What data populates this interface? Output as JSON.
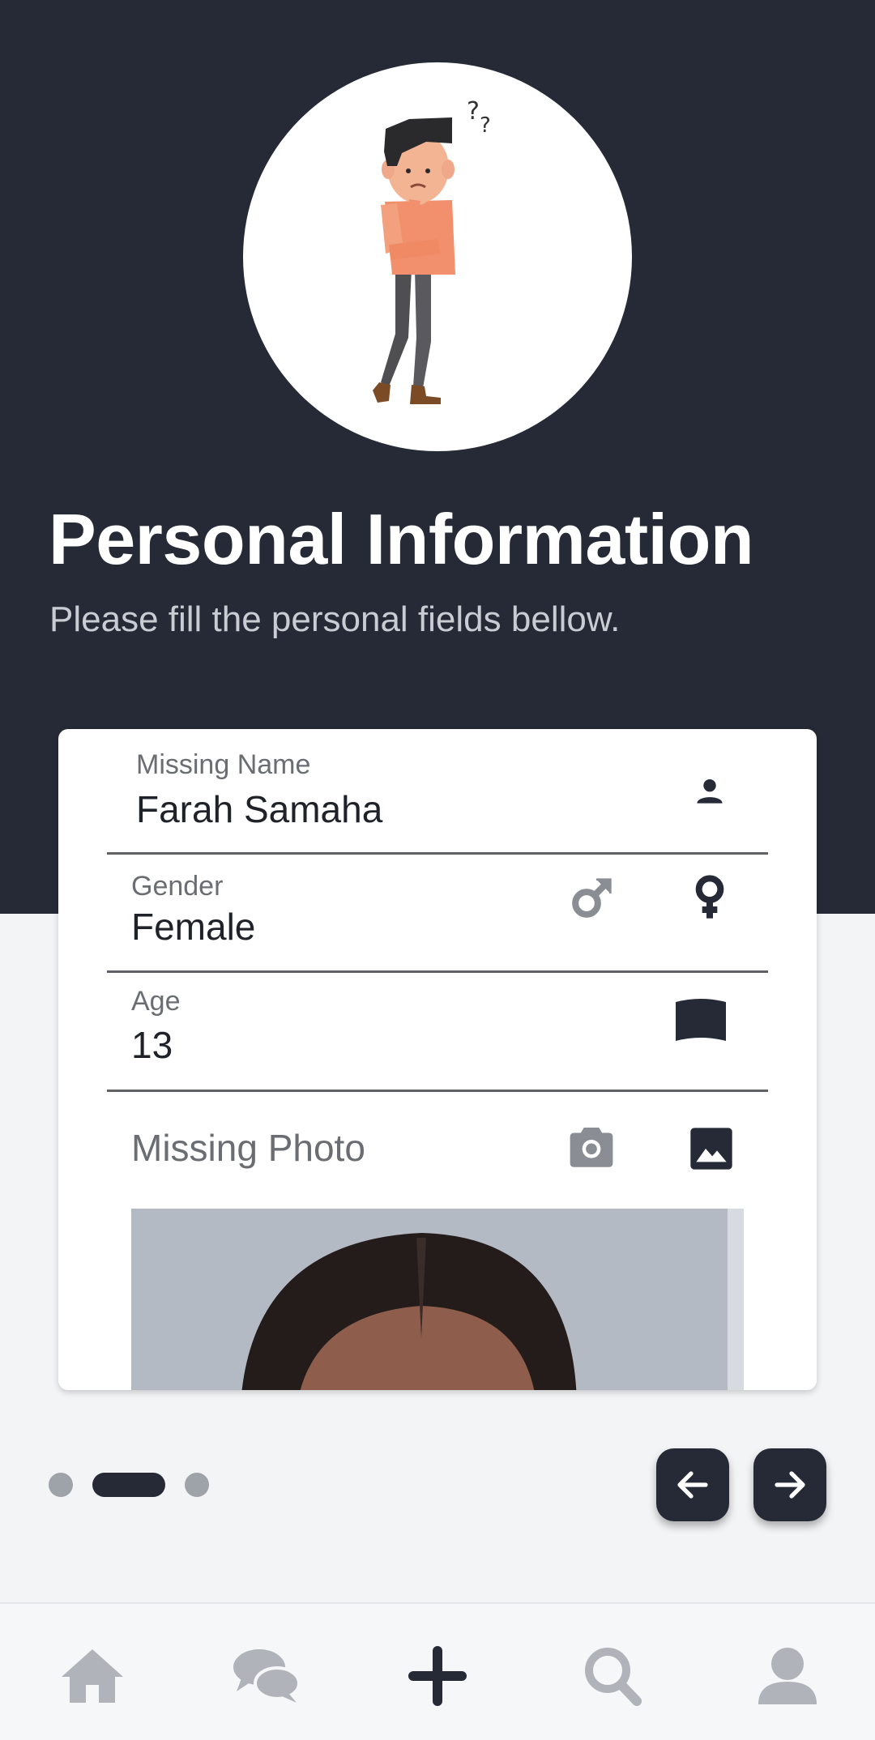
{
  "header": {
    "title": "Personal Information",
    "subtitle": "Please fill the personal fields bellow."
  },
  "form": {
    "name": {
      "label": "Missing Name",
      "value": "Farah Samaha",
      "icon": "person-icon"
    },
    "gender": {
      "label": "Gender",
      "value": "Female",
      "options": [
        "male-icon",
        "female-icon"
      ],
      "selected": "female"
    },
    "age": {
      "label": "Age",
      "value": "13",
      "icon": "flag-icon"
    },
    "photo": {
      "label": "Missing Photo",
      "icons": [
        "camera-icon",
        "image-icon"
      ]
    }
  },
  "pager": {
    "total": 3,
    "active_index": 1
  },
  "nav_buttons": [
    "back-arrow-icon",
    "forward-arrow-icon"
  ],
  "bottom_nav": {
    "items": [
      "home-icon",
      "chat-icon",
      "add-icon",
      "search-icon",
      "profile-icon"
    ],
    "active": "add-icon"
  },
  "colors": {
    "dark": "#252a36",
    "page_bg": "#f3f4f6",
    "muted_icon": "#8a8d93",
    "inactive_tab": "#b0b4ba"
  }
}
